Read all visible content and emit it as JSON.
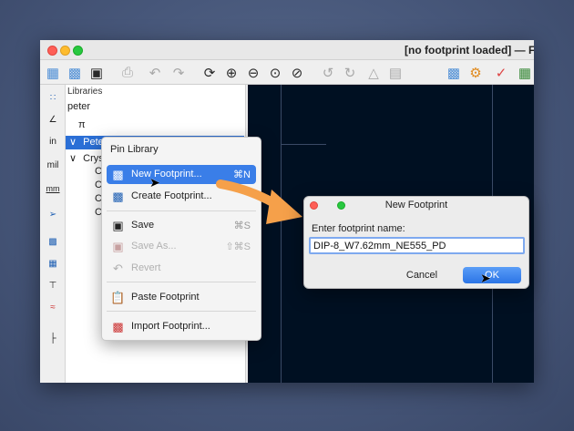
{
  "window": {
    "title": "[no footprint loaded] — Foot"
  },
  "libraries": {
    "header": "Libraries",
    "search_value": "peter",
    "rows": [
      {
        "arrow": "",
        "label": "π"
      },
      {
        "arrow": "∨",
        "label": "Pete"
      },
      {
        "arrow": "∨",
        "label": "Crys"
      },
      {
        "arrow": "",
        "label": "C"
      },
      {
        "arrow": "",
        "label": "C"
      },
      {
        "arrow": "",
        "label": "C"
      },
      {
        "arrow": "",
        "label": "C"
      }
    ]
  },
  "left_tools": {
    "unit_in": "in",
    "unit_mil": "mil",
    "unit_mm": "mm"
  },
  "context_menu": {
    "header": "Pin Library",
    "items": [
      {
        "label": "New Footprint...",
        "shortcut": "⌘N"
      },
      {
        "label": "Create Footprint...",
        "shortcut": ""
      },
      {
        "label": "Save",
        "shortcut": "⌘S"
      },
      {
        "label": "Save As...",
        "shortcut": "⇧⌘S"
      },
      {
        "label": "Revert",
        "shortcut": ""
      },
      {
        "label": "Paste Footprint",
        "shortcut": ""
      },
      {
        "label": "Import Footprint...",
        "shortcut": ""
      }
    ]
  },
  "dialog": {
    "title": "New Footprint",
    "prompt": "Enter footprint name:",
    "input_value": "DIP-8_W7.62mm_NE555_PD",
    "cancel_label": "Cancel",
    "ok_label": "OK"
  },
  "colors": {
    "accent": "#3a7ee8",
    "arrow": "#f5a04a",
    "canvas": "#001022"
  },
  "icons": {
    "toolbar": [
      "library-icon",
      "footprint-icon",
      "save-icon",
      "print-icon",
      "undo-icon",
      "redo-icon",
      "refresh-icon",
      "zoom-in-icon",
      "zoom-out-icon",
      "zoom-fit-icon",
      "zoom-select-icon",
      "rotate-ccw-icon",
      "rotate-cw-icon",
      "mirror-icon",
      "align-icon",
      "pad-icon",
      "settings-icon",
      "check-icon",
      "board-icon"
    ]
  }
}
